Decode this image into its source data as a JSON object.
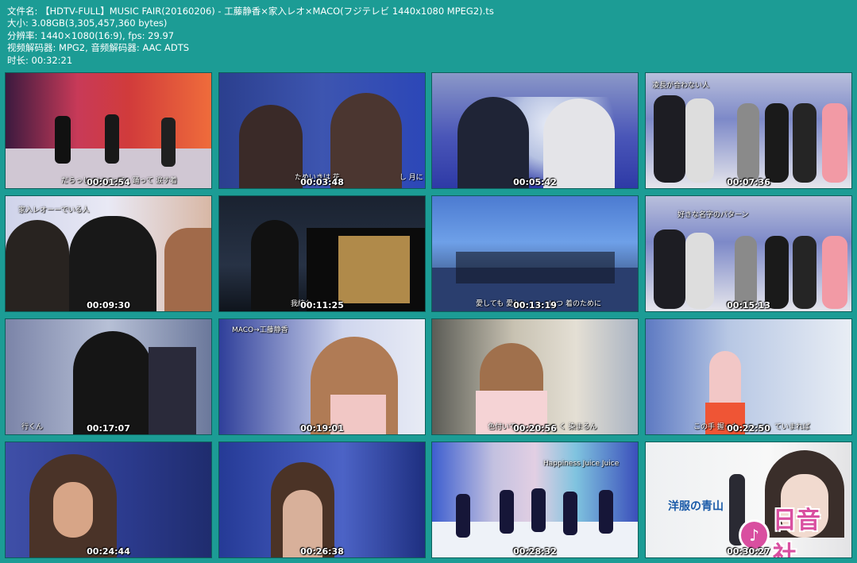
{
  "info": {
    "filename": "文件名: 【HDTV-FULL】MUSIC FAIR(20160206) - 工藤静香×家入レオ×MACO(フジテレビ 1440x1080 MPEG2).ts",
    "size": "大小: 3.08GB(3,305,457,360 bytes)",
    "resolution": "分辨率: 1440×1080(16:9), fps: 29.97",
    "codec": "视频解码器: MPG2, 音频解码器: AAC ADTS",
    "duration": "时长: 00:32:21"
  },
  "thumbnails": [
    {
      "time": "00:01:54",
      "sub": "だらっしゃい…って　踊って 涙す着"
    },
    {
      "time": "00:03:48",
      "sub": "ためいきは 花 　　　　　　　　し 月に 愛えて"
    },
    {
      "time": "00:05:42",
      "sub": ""
    },
    {
      "time": "00:07:36",
      "sub": "凌長が合わない人"
    },
    {
      "time": "00:09:30",
      "sub": "家入レオーーでいる人"
    },
    {
      "time": "00:11:25",
      "sub": "我統も"
    },
    {
      "time": "00:13:19",
      "sub": "愛しても 愛し　　　　いつ 着のために"
    },
    {
      "time": "00:15:13",
      "sub": "好きな名字のパターン"
    },
    {
      "time": "00:17:07",
      "sub": "行くん"
    },
    {
      "time": "00:19:01",
      "sub": "MACO→工藤静香"
    },
    {
      "time": "00:20:56",
      "sub": "色付いて　　　　　　く 染まるん"
    },
    {
      "time": "00:22:50",
      "sub": "この手 握った　　　　　ていまれば"
    },
    {
      "time": "00:24:44",
      "sub": ""
    },
    {
      "time": "00:26:38",
      "sub": ""
    },
    {
      "time": "00:28:32",
      "sub": "Happiness Juice Juice"
    },
    {
      "time": "00:30:27",
      "sub": ""
    }
  ],
  "ad": {
    "text": "洋服の青山"
  },
  "logo": {
    "text": "日音社",
    "icon": "music-note-icon"
  }
}
